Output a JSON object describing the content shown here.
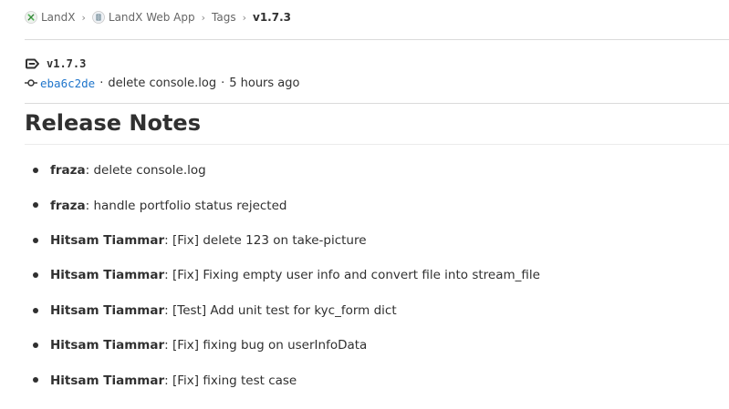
{
  "breadcrumb": {
    "items": [
      {
        "label": "LandX",
        "icon": "project-avatar-x-icon"
      },
      {
        "label": "LandX Web App",
        "icon": "project-avatar-icon"
      },
      {
        "label": "Tags"
      }
    ],
    "current": "v1.7.3"
  },
  "tag": {
    "name": "v1.7.3",
    "icon": "tag-icon"
  },
  "commit": {
    "sha": "eba6c2de",
    "message": "delete console.log",
    "time": "5 hours ago",
    "separator": "·",
    "icon": "commit-icon"
  },
  "release": {
    "title": "Release Notes",
    "notes": [
      {
        "author": "fraza",
        "text": ": delete console.log"
      },
      {
        "author": "fraza",
        "text": ": handle portfolio status rejected"
      },
      {
        "author": "Hitsam Tiammar",
        "text": ": [Fix] delete 123 on take-picture"
      },
      {
        "author": "Hitsam Tiammar",
        "text": ": [Fix] Fixing empty user info and convert file into stream_file"
      },
      {
        "author": "Hitsam Tiammar",
        "text": ": [Test] Add unit test for kyc_form dict"
      },
      {
        "author": "Hitsam Tiammar",
        "text": ": [Fix] fixing bug on userInfoData"
      },
      {
        "author": "Hitsam Tiammar",
        "text": ": [Fix] fixing test case"
      }
    ]
  },
  "colors": {
    "link": "#1f75cb",
    "text": "#303030",
    "muted": "#666666",
    "divider": "#dbdbdb"
  }
}
